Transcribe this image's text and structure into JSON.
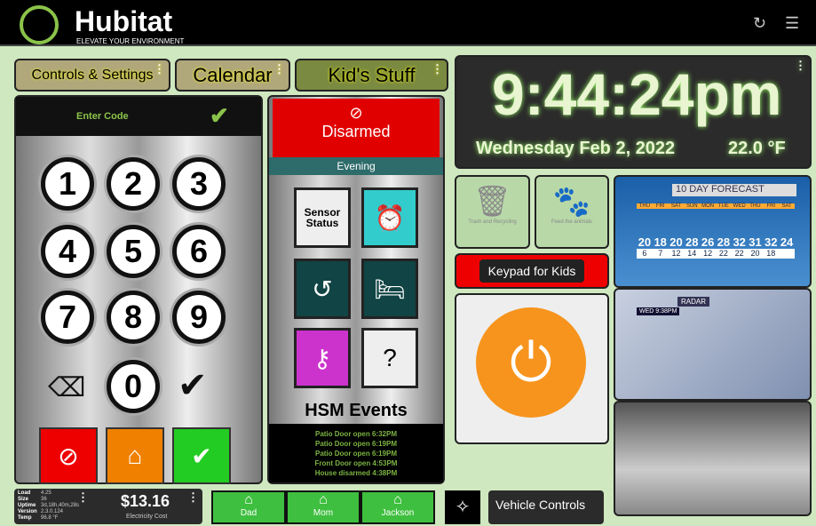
{
  "header": {
    "brand": "Hubitat",
    "tagline": "ELEVATE YOUR ENVIRONMENT",
    "refresh_icon": "refresh-icon",
    "menu_icon": "menu-icon"
  },
  "nav": {
    "controls": "Controls & Settings",
    "calendar": "Calendar",
    "kids": "Kid's Stuff"
  },
  "keypad": {
    "prompt": "Enter Code",
    "keys": [
      "1",
      "2",
      "3",
      "4",
      "5",
      "6",
      "7",
      "8",
      "9",
      "0"
    ]
  },
  "hsm": {
    "status": "Disarmed",
    "mode": "Evening",
    "sensor_status": "Sensor Status",
    "events_title": "HSM Events",
    "events": [
      "Patio Door open 6:32PM",
      "Patio Door open 6:19PM",
      "Patio Door open 6:19PM",
      "Front Door open 4:53PM",
      "House disarmed 4:38PM"
    ],
    "colors": {
      "disarmed": "#e00000",
      "mode": "#2e6b6b"
    }
  },
  "clock": {
    "time": "9:44:24pm",
    "date": "Wednesday Feb 2, 2022",
    "temp": "22.0 °F"
  },
  "tiles": {
    "trash": "Trash and Recycling",
    "feed": "Feed the animals",
    "keypad_kids": "Keypad for Kids"
  },
  "forecast": {
    "title": "10 DAY FORECAST",
    "days": [
      "THU",
      "FRI",
      "SAT",
      "SUN",
      "MON",
      "TUE",
      "WED",
      "THU",
      "FRI",
      "SAT"
    ],
    "highs": [
      "20",
      "18",
      "20",
      "28",
      "26",
      "28",
      "32",
      "31",
      "32",
      "24"
    ],
    "lows": [
      "6",
      "7",
      "12",
      "14",
      "12",
      "22",
      "22",
      "20",
      "18"
    ]
  },
  "radar": {
    "title": "RADAR",
    "day": "WED 9:38PM"
  },
  "hub": {
    "rows": [
      [
        "Load",
        "4.25"
      ],
      [
        "Size",
        "36"
      ],
      [
        "Uptime",
        "3d,18h,40m,28s"
      ],
      [
        "Version",
        "2.3.0.124"
      ],
      [
        "Temp",
        "96.8 °F"
      ]
    ]
  },
  "electricity": {
    "value": "$13.16",
    "label": "Electricity Cost"
  },
  "presence": [
    "Dad",
    "Mom",
    "Jackson"
  ],
  "vehicle": "Vehicle Controls"
}
